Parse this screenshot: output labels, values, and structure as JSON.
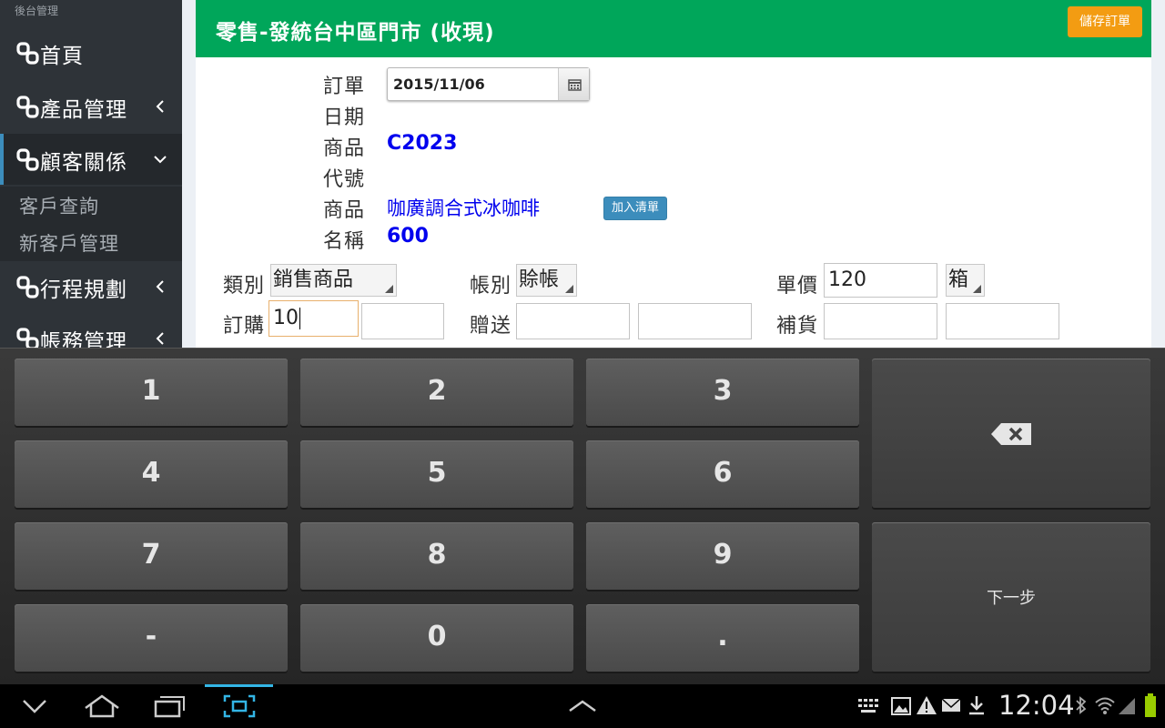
{
  "sidebar": {
    "brand": "後台管理",
    "items": [
      {
        "label": "首頁",
        "icon": "link-icon"
      },
      {
        "label": "產品管理",
        "icon": "link-icon",
        "chevron": "chevron-left-icon"
      },
      {
        "label": "顧客關係",
        "icon": "link-icon",
        "chevron": "chevron-down-icon",
        "active": true
      },
      {
        "label": "行程規劃",
        "icon": "link-icon",
        "chevron": "chevron-left-icon"
      },
      {
        "label": "帳務管理",
        "icon": "link-icon",
        "chevron": "chevron-left-icon"
      }
    ],
    "subitems": [
      "客戶查詢",
      "新客戶管理"
    ]
  },
  "header": {
    "title": "零售-發統台中區門市 (收現)",
    "save_label": "儲存訂單"
  },
  "form": {
    "order_date_label_1": "訂單",
    "order_date_label_2": "日期",
    "order_date": "2015/11/06",
    "product_code_label_1": "商品",
    "product_code_label_2": "代號",
    "product_code": "C2023",
    "product_name_label_1": "商品",
    "product_name_label_2": "名稱",
    "product_name": "咖廣調合式冰咖啡",
    "product_qty": "600",
    "add_to_list_label": "加入清單",
    "category_label": "類別",
    "category_value": "銷售商品",
    "account_label": "帳別",
    "account_value": "賒帳",
    "unit_price_label": "單價",
    "unit_price_value": "120",
    "unit_value": "箱",
    "order_qty_label": "訂購",
    "order_qty_value": "10",
    "gift_label": "贈送",
    "restock_label": "補貨"
  },
  "keyboard": {
    "keys": [
      "1",
      "2",
      "3",
      "4",
      "5",
      "6",
      "7",
      "8",
      "9",
      "-",
      "0",
      "."
    ],
    "backspace_icon": "backspace-icon",
    "next_label": "下一步"
  },
  "statusbar": {
    "time": "12:04"
  },
  "colors": {
    "header_green": "#00a65a",
    "save_orange": "#f39c12",
    "add_blue": "#3c8dbc",
    "sidebar_bg": "#2e3338"
  }
}
